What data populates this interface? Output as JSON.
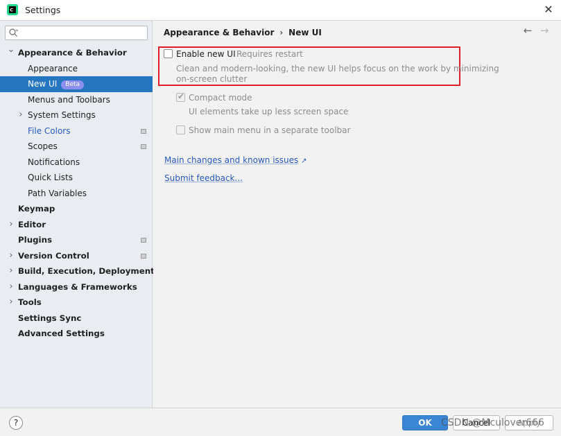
{
  "window": {
    "title": "Settings",
    "close_glyph": "✕"
  },
  "search": {
    "placeholder": ""
  },
  "sidebar": {
    "items": [
      {
        "label": "Appearance & Behavior",
        "level": 0,
        "bold": true,
        "expandable": true,
        "expanded": true
      },
      {
        "label": "Appearance",
        "level": 1
      },
      {
        "label": "New UI",
        "level": 1,
        "selected": true,
        "badge": "Beta"
      },
      {
        "label": "Menus and Toolbars",
        "level": 1
      },
      {
        "label": "System Settings",
        "level": 1,
        "expandable": true
      },
      {
        "label": "File Colors",
        "level": 1,
        "blue": true,
        "mark": true
      },
      {
        "label": "Scopes",
        "level": 1,
        "mark": true
      },
      {
        "label": "Notifications",
        "level": 1
      },
      {
        "label": "Quick Lists",
        "level": 1
      },
      {
        "label": "Path Variables",
        "level": 1
      },
      {
        "label": "Keymap",
        "level": 0,
        "bold": true
      },
      {
        "label": "Editor",
        "level": 0,
        "bold": true,
        "expandable": true
      },
      {
        "label": "Plugins",
        "level": 0,
        "bold": true,
        "mark": true
      },
      {
        "label": "Version Control",
        "level": 0,
        "bold": true,
        "expandable": true,
        "mark": true
      },
      {
        "label": "Build, Execution, Deployment",
        "level": 0,
        "bold": true,
        "expandable": true
      },
      {
        "label": "Languages & Frameworks",
        "level": 0,
        "bold": true,
        "expandable": true
      },
      {
        "label": "Tools",
        "level": 0,
        "bold": true,
        "expandable": true
      },
      {
        "label": "Settings Sync",
        "level": 0,
        "bold": true
      },
      {
        "label": "Advanced Settings",
        "level": 0,
        "bold": true
      }
    ]
  },
  "breadcrumb": {
    "parent": "Appearance & Behavior",
    "separator": "›",
    "current": "New UI",
    "back_glyph": "←",
    "forward_glyph": "→"
  },
  "options": {
    "enable_new_ui": {
      "label": "Enable new UI",
      "note": "Requires restart",
      "checked": false,
      "description_line1": "Clean and modern-looking, the new UI helps focus on the work by minimizing",
      "description_line2": "on-screen clutter"
    },
    "compact_mode": {
      "label": "Compact mode",
      "checked": true,
      "enabled": false,
      "description": "UI elements take up less screen space"
    },
    "separate_toolbar": {
      "label": "Show main menu in a separate toolbar",
      "checked": false,
      "enabled": false
    }
  },
  "links": {
    "main_changes": "Main changes and known issues",
    "main_changes_arrow": "↗",
    "feedback": "Submit feedback..."
  },
  "footer": {
    "help": "?",
    "ok": "OK",
    "cancel": "Cancel",
    "apply": "Apply",
    "watermark": "CSDN @Mculover666"
  },
  "colors": {
    "selection": "#2675bf",
    "highlight_border": "#dc1d2a",
    "link": "#2659b8",
    "ok_button": "#3a86d4"
  }
}
